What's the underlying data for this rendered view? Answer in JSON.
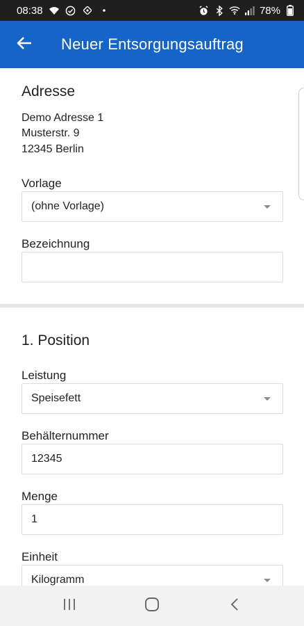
{
  "status_bar": {
    "time": "08:38",
    "battery": "78%",
    "icons_left": [
      "wifi-icon",
      "check-circle-icon",
      "location-icon",
      "dot-icon"
    ],
    "icons_right": [
      "alarm-icon",
      "bluetooth-icon",
      "wifi-signal-icon",
      "cell-signal-icon",
      "battery-icon"
    ]
  },
  "app_bar": {
    "title": "Neuer Entsorgungsauftrag",
    "back_icon": "arrow-left-icon",
    "color": "#1565c8"
  },
  "address": {
    "section_title": "Adresse",
    "line1": "Demo Adresse 1",
    "line2": "Musterstr. 9",
    "line3": "12345 Berlin"
  },
  "vorlage": {
    "label": "Vorlage",
    "value": "(ohne Vorlage)"
  },
  "bezeichnung": {
    "label": "Bezeichnung",
    "value": ""
  },
  "position": {
    "section_title": "1. Position",
    "leistung": {
      "label": "Leistung",
      "value": "Speisefett"
    },
    "behaelternummer": {
      "label": "Behälternummer",
      "value": "12345"
    },
    "menge": {
      "label": "Menge",
      "value": "1"
    },
    "einheit": {
      "label": "Einheit",
      "value": "Kilogramm"
    }
  },
  "nav_bar": {
    "icons": [
      "recent-apps-icon",
      "home-icon",
      "back-icon"
    ]
  }
}
